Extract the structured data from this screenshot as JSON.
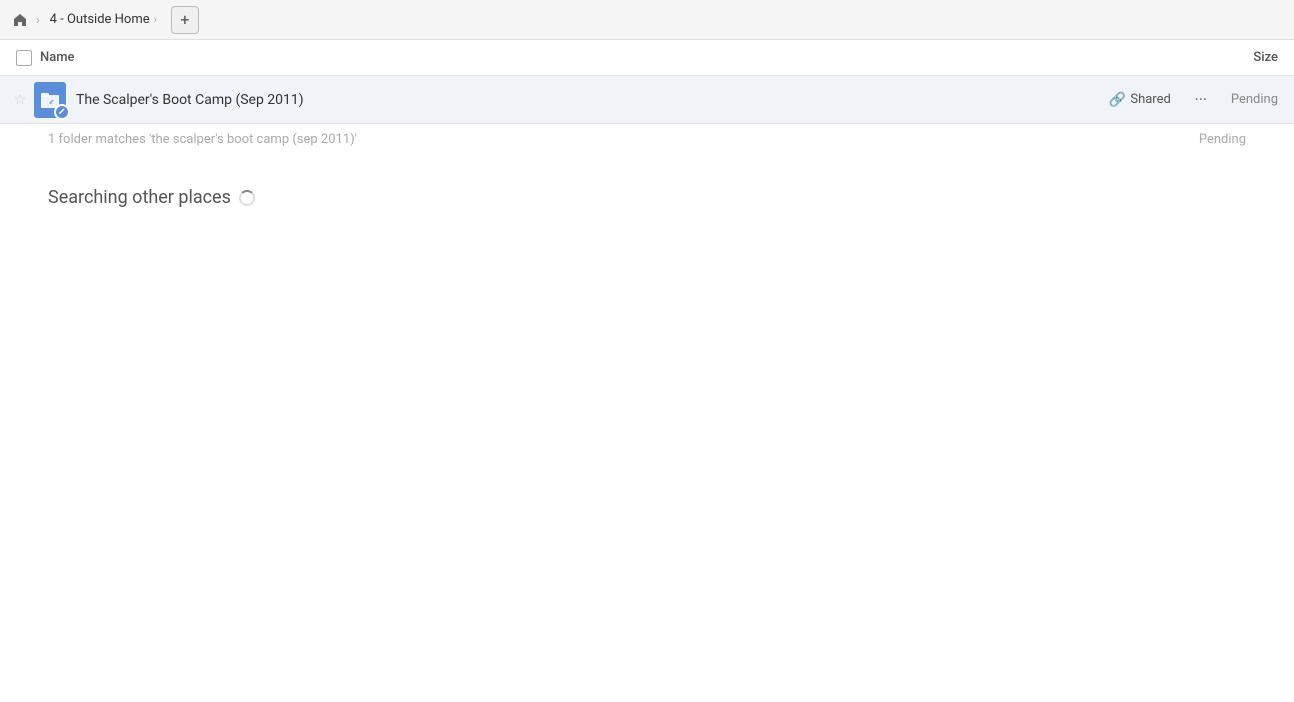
{
  "header": {
    "home_icon": "🏠",
    "breadcrumb": {
      "separator": "›",
      "current": "4 - Outside Home"
    },
    "add_button_label": "+"
  },
  "columns": {
    "name_label": "Name",
    "size_label": "Size"
  },
  "file_row": {
    "name": "The Scalper's Boot Camp (Sep 2011)",
    "shared_label": "Shared",
    "more_label": "•••",
    "status": "Pending",
    "star_icon": "★"
  },
  "search_results": {
    "count_text": "1 folder matches 'the scalper's boot camp (sep 2011)'",
    "count_status": "Pending"
  },
  "searching_other": {
    "label": "Searching other places"
  }
}
